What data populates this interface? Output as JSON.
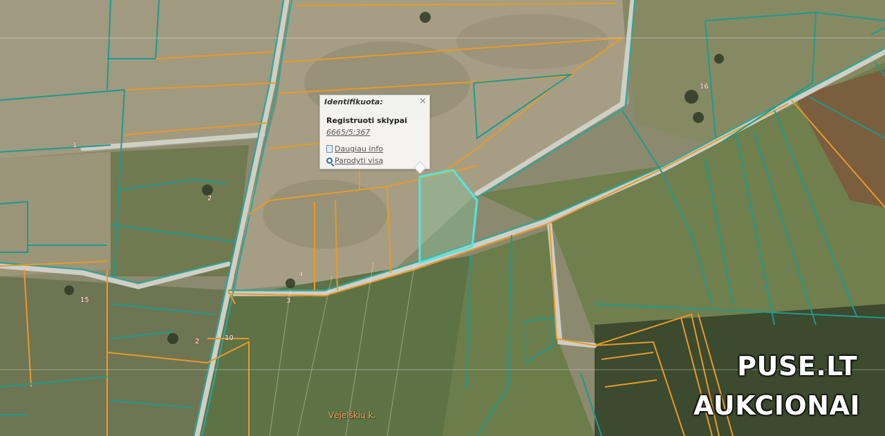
{
  "popup": {
    "title": "Identifikuota:",
    "close": "×",
    "layer": "Registruoti sklypai",
    "parcel_id": "6665/5:367",
    "more_info": "Daugiau info",
    "show_all": "Parodyti visą",
    "more_icon": "document-icon",
    "show_icon": "magnifier-icon"
  },
  "watermark": {
    "line1": "PUSE.LT",
    "line2": "AUKCIONAI"
  },
  "place_label": "Vėjelškių k.",
  "house_numbers": [
    "1",
    "2",
    "4",
    "3",
    "15",
    "2",
    "10",
    "16"
  ],
  "colors": {
    "boundary_orange": "#e89a2a",
    "boundary_teal": "#1e9a8e",
    "selected_parcel": "#52e6e0",
    "road": "#c9c9c0"
  }
}
